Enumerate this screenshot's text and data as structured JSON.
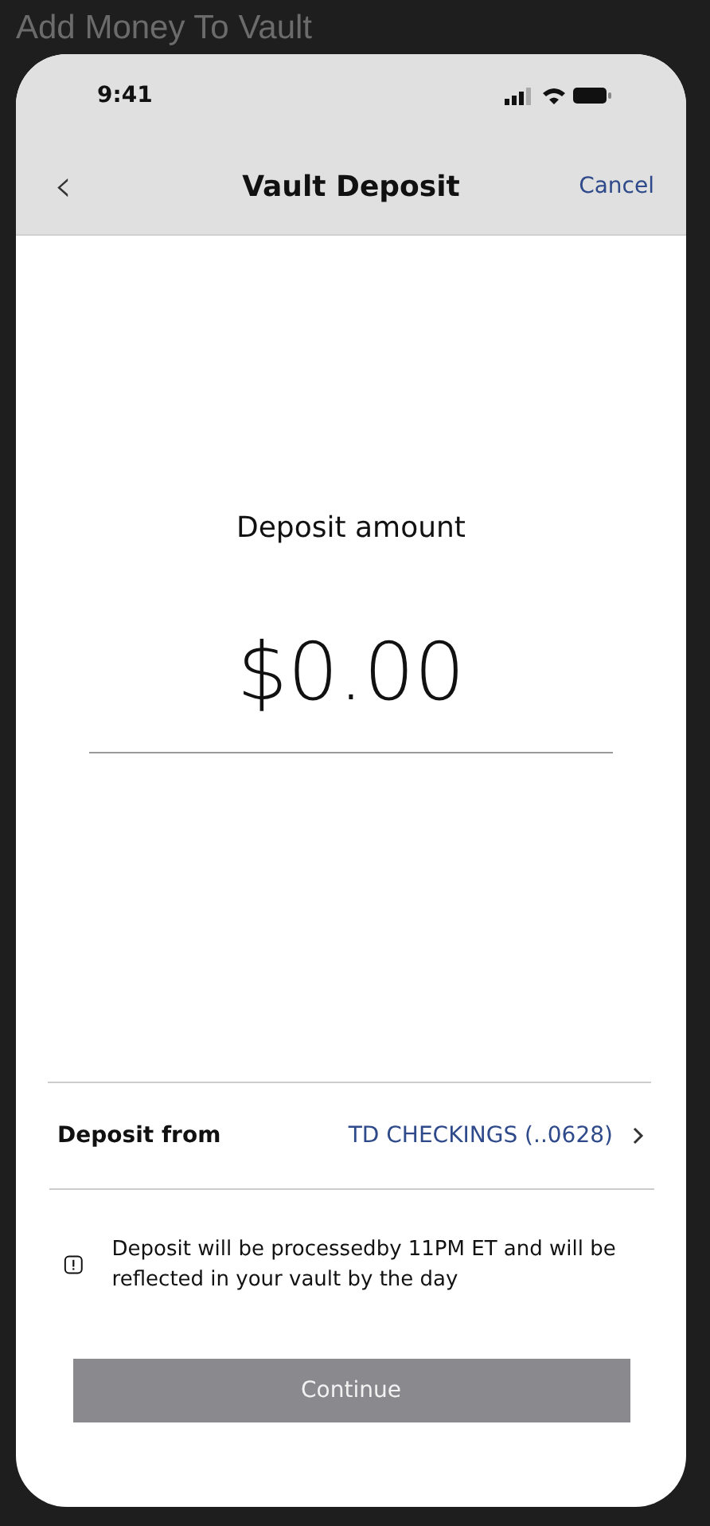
{
  "window": {
    "title": "Add Money To Vault"
  },
  "status_bar": {
    "time": "9:41"
  },
  "nav": {
    "back": "‹",
    "title": "Vault Deposit",
    "cancel": "Cancel"
  },
  "amount": {
    "label": "Deposit amount",
    "value": "$0.00"
  },
  "source": {
    "label": "Deposit from",
    "value": "TD CHECKINGS (..0628)"
  },
  "notice": "Deposit will be processedby 11PM ET and will be reflected in your vault by the day",
  "continue_button": {
    "label": "Continue",
    "disabled": true
  }
}
